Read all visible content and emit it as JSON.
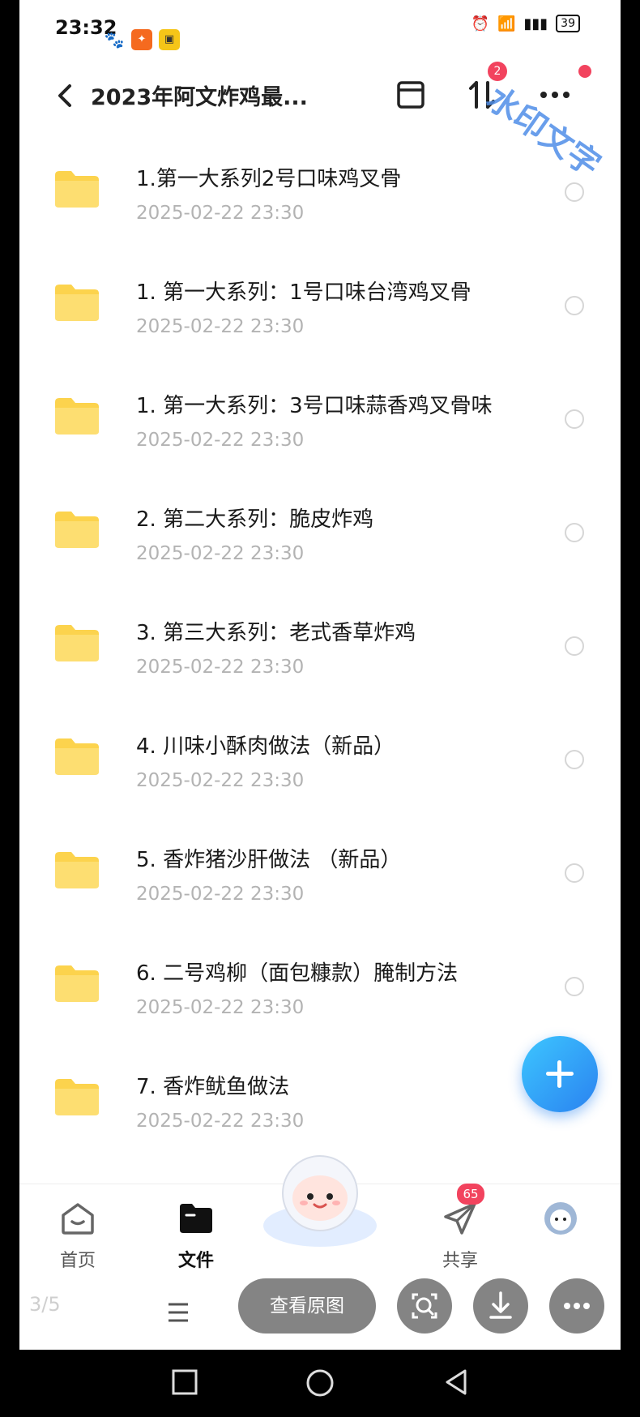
{
  "status_bar": {
    "time": "23:32",
    "battery": "39"
  },
  "header": {
    "title": "2023年阿文炸鸡最...",
    "sort_badge": "2",
    "watermark": "水印文字"
  },
  "files": [
    {
      "name": "1.第一大系列2号口味鸡叉骨",
      "date": "2025-02-22  23:30"
    },
    {
      "name": "1. 第一大系列：1号口味台湾鸡叉骨",
      "date": "2025-02-22  23:30"
    },
    {
      "name": "1. 第一大系列：3号口味蒜香鸡叉骨味",
      "date": "2025-02-22  23:30"
    },
    {
      "name": "2. 第二大系列：脆皮炸鸡",
      "date": "2025-02-22  23:30"
    },
    {
      "name": "3. 第三大系列：老式香草炸鸡",
      "date": "2025-02-22  23:30"
    },
    {
      "name": "4. 川味小酥肉做法（新品）",
      "date": "2025-02-22  23:30"
    },
    {
      "name": "5. 香炸猪沙肝做法 （新品）",
      "date": "2025-02-22  23:30"
    },
    {
      "name": "6.  二号鸡柳（面包糠款）腌制方法",
      "date": "2025-02-22  23:30"
    },
    {
      "name": "7. 香炸鱿鱼做法",
      "date": "2025-02-22  23:30"
    }
  ],
  "tabbar": {
    "home": "首页",
    "files": "文件",
    "share": "共享",
    "share_badge": "65"
  },
  "viewer": {
    "page_indicator": "3/5",
    "view_original": "查看原图"
  },
  "colors": {
    "accent": "#2a82f0",
    "badge": "#f2435e",
    "folder": "#fcd34d"
  }
}
